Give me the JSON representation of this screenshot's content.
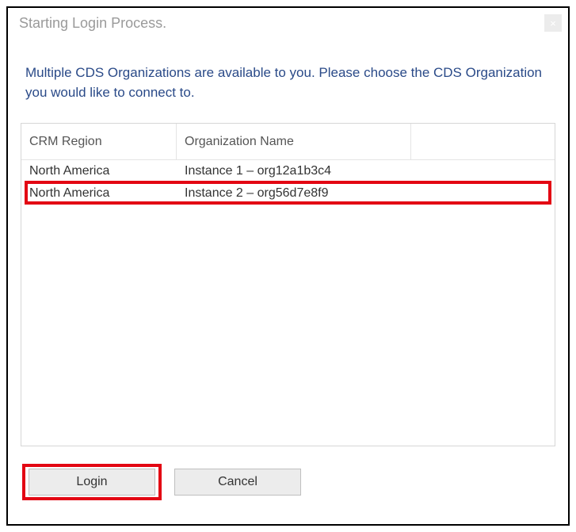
{
  "titlebar": {
    "title": "Starting Login Process.",
    "close_glyph": "×"
  },
  "instructions": "Multiple CDS Organizations are available to you. Please choose the CDS Organization you would like to connect to.",
  "grid": {
    "headers": {
      "region": "CRM Region",
      "org": "Organization Name"
    },
    "rows": [
      {
        "region": "North America",
        "org": "Instance 1 – org12a1b3c4"
      },
      {
        "region": "North America",
        "org": "Instance 2 – org56d7e8f9"
      }
    ],
    "highlighted_row_index": 1
  },
  "buttons": {
    "login": "Login",
    "cancel": "Cancel",
    "highlighted": "login"
  }
}
